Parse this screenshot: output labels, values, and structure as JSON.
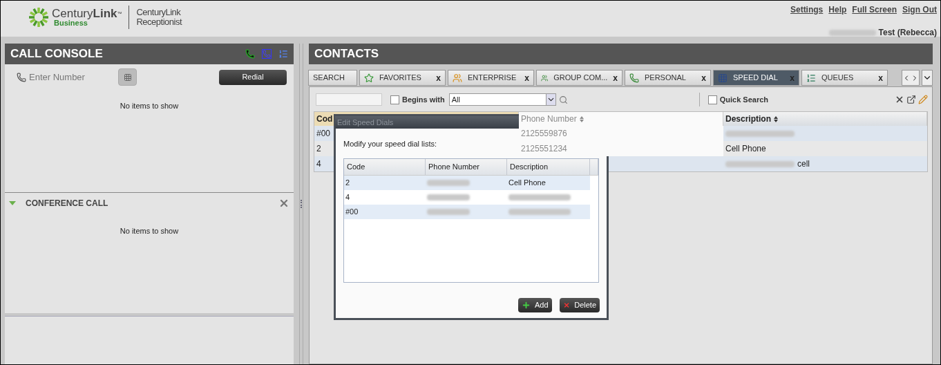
{
  "header": {
    "logo": {
      "brand_light": "Century",
      "brand_bold": "Link",
      "tm": "™",
      "sub": "Business"
    },
    "product": [
      "CenturyLink",
      "Receptionist"
    ],
    "links": [
      "Settings",
      "Help",
      "Full Screen",
      "Sign Out"
    ],
    "user": [
      {
        "kind": "blur"
      },
      {
        "kind": "text",
        "text": "Test (Rebecca)"
      }
    ]
  },
  "call_console": {
    "title": "CALL CONSOLE",
    "placeholder": "Enter Number",
    "redial": "Redial",
    "empty": "No items to show"
  },
  "conference": {
    "title": "CONFERENCE CALL",
    "expanded": true,
    "empty": "No items to show"
  },
  "contacts": {
    "title": "CONTACTS",
    "tabs": [
      {
        "label": "SEARCH",
        "kind": "search",
        "selected": false
      },
      {
        "label": "FAVORITES",
        "kind": "favorites",
        "selected": false,
        "close": "x"
      },
      {
        "label": "ENTERPRISE",
        "kind": "enterprise",
        "selected": false,
        "close": "x"
      },
      {
        "label": "GROUP COM...",
        "kind": "group",
        "selected": false,
        "close": "x"
      },
      {
        "label": "PERSONAL",
        "kind": "personal",
        "selected": false,
        "close": "x"
      },
      {
        "label": "SPEED DIAL",
        "kind": "speed",
        "selected": true,
        "close": "x"
      },
      {
        "label": "QUEUES",
        "kind": "queues",
        "selected": false,
        "close": "x"
      }
    ],
    "filter": {
      "begins_with": {
        "label": "Begins with",
        "checked": false
      },
      "select": "All",
      "quick_search": {
        "label": "Quick Search",
        "checked": false
      }
    },
    "columns": [
      {
        "label": "Cod",
        "sorted": true
      },
      {
        "label": "Phone Number",
        "sorted": false
      },
      {
        "label": "Description",
        "sorted": false
      }
    ],
    "rows": [
      {
        "code": "#00",
        "phone": "2125559876",
        "description": [
          {
            "kind": "blur"
          }
        ]
      },
      {
        "code": "2",
        "phone": "2125551234",
        "description": [
          {
            "kind": "text",
            "text": "Cell Phone"
          }
        ]
      },
      {
        "code": "4",
        "description": [
          {
            "kind": "blur"
          },
          {
            "kind": "text",
            "text": "cell"
          }
        ]
      }
    ]
  },
  "dialog": {
    "title": "Edit Speed Dials",
    "intro": "Modify your speed dial lists:",
    "columns": [
      "Code",
      "Phone Number",
      "Description"
    ],
    "rows": [
      {
        "code": "2",
        "phone": [
          {
            "kind": "blur"
          }
        ],
        "description": [
          {
            "kind": "text",
            "text": "Cell Phone"
          }
        ]
      },
      {
        "code": "4",
        "phone": [
          {
            "kind": "blur"
          }
        ],
        "description": [
          {
            "kind": "blur"
          }
        ]
      },
      {
        "code": "#00",
        "phone": [
          {
            "kind": "blur"
          }
        ],
        "description": [
          {
            "kind": "blur"
          }
        ]
      }
    ],
    "buttons": [
      {
        "kind": "add",
        "label": "Add"
      },
      {
        "kind": "delete",
        "label": "Delete"
      }
    ]
  }
}
